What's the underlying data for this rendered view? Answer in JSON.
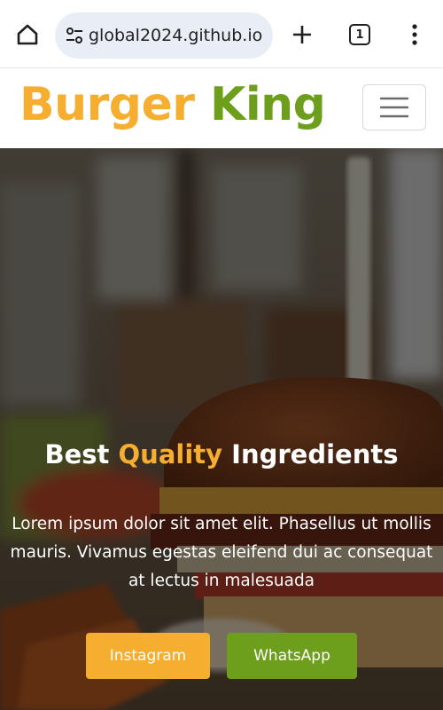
{
  "browser": {
    "url": "global2024.github.io",
    "tab_count": "1",
    "icons": [
      "home-icon",
      "site-settings-icon",
      "new-tab-plus-icon",
      "tab-switcher-icon",
      "more-vert-icon"
    ]
  },
  "header": {
    "brand_part1": "Burger",
    "brand_part2": "King",
    "icons": [
      "hamburger-menu-icon"
    ]
  },
  "hero": {
    "title_part1": "Best",
    "title_accent": "Quality",
    "title_part2": "Ingredients",
    "text_lines": [
      "Lorem ipsum dolor sit amet elit. Phasellus ut mollis",
      "mauris. Vivamus egestas eleifend dui ac consequat",
      "at lectus in malesuada"
    ],
    "button_instagram": "Instagram",
    "button_whatsapp": "WhatsApp"
  },
  "colors": {
    "brand_orange": "#f5ae2f",
    "brand_green": "#6d9e1c"
  }
}
